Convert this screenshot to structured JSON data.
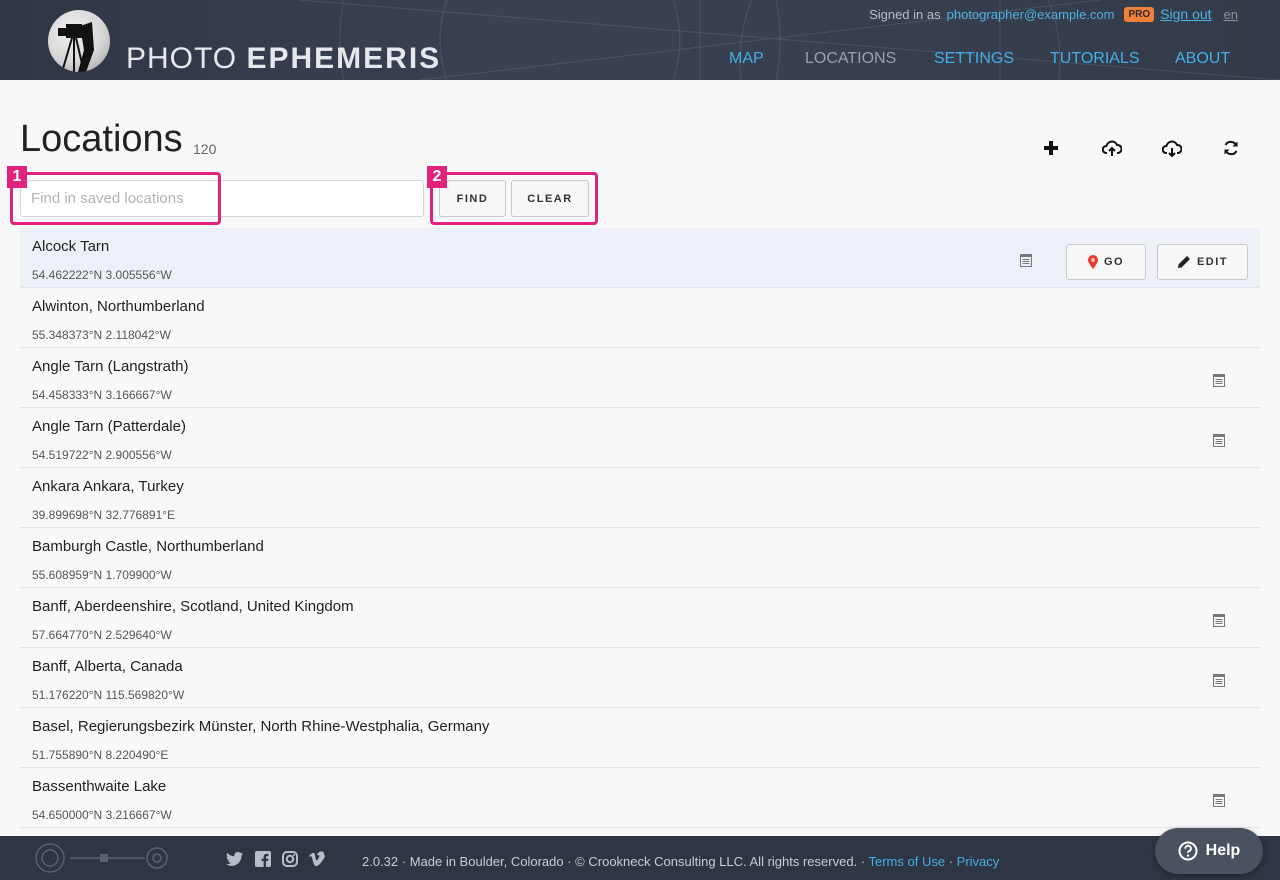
{
  "header": {
    "brand_light": "PHOTO",
    "brand_bold": "EPHEMERIS",
    "signed_in_prefix": "Signed in as",
    "email": "photographer@example.com",
    "pro_badge": "PRO",
    "sign_out": "Sign out",
    "language": "en",
    "nav": [
      {
        "label": "MAP"
      },
      {
        "label": "LOCATIONS"
      },
      {
        "label": "SETTINGS"
      },
      {
        "label": "TUTORIALS"
      },
      {
        "label": "ABOUT"
      }
    ]
  },
  "page": {
    "title": "Locations",
    "count": "120",
    "search_placeholder": "Find in saved locations",
    "search_value": "",
    "find_label": "FIND",
    "clear_label": "CLEAR"
  },
  "annotations": [
    "1",
    "2"
  ],
  "row_actions": {
    "go_label": "GO",
    "edit_label": "EDIT"
  },
  "locations": [
    {
      "name": "Alcock Tarn",
      "coords": "54.462222°N 3.005556°W"
    },
    {
      "name": "Alwinton, Northumberland",
      "coords": "55.348373°N 2.118042°W"
    },
    {
      "name": "Angle Tarn (Langstrath)",
      "coords": "54.458333°N 3.166667°W"
    },
    {
      "name": "Angle Tarn (Patterdale)",
      "coords": "54.519722°N 2.900556°W"
    },
    {
      "name": "Ankara Ankara, Turkey",
      "coords": "39.899698°N 32.776891°E"
    },
    {
      "name": "Bamburgh Castle, Northumberland",
      "coords": "55.608959°N 1.709900°W"
    },
    {
      "name": "Banff, Aberdeenshire, Scotland, United Kingdom",
      "coords": "57.664770°N 2.529640°W"
    },
    {
      "name": "Banff, Alberta, Canada",
      "coords": "51.176220°N 115.569820°W"
    },
    {
      "name": "Basel, Regierungsbezirk Münster, North Rhine-Westphalia, Germany",
      "coords": "51.755890°N 8.220490°E"
    },
    {
      "name": "Bassenthwaite Lake",
      "coords": "54.650000°N 3.216667°W"
    }
  ],
  "footer": {
    "text": "2.0.32 · Made in Boulder, Colorado · © Crookneck Consulting LLC. All rights reserved. ·",
    "terms": "Terms of Use",
    "separator": "·",
    "privacy": "Privacy",
    "help": "Help"
  }
}
